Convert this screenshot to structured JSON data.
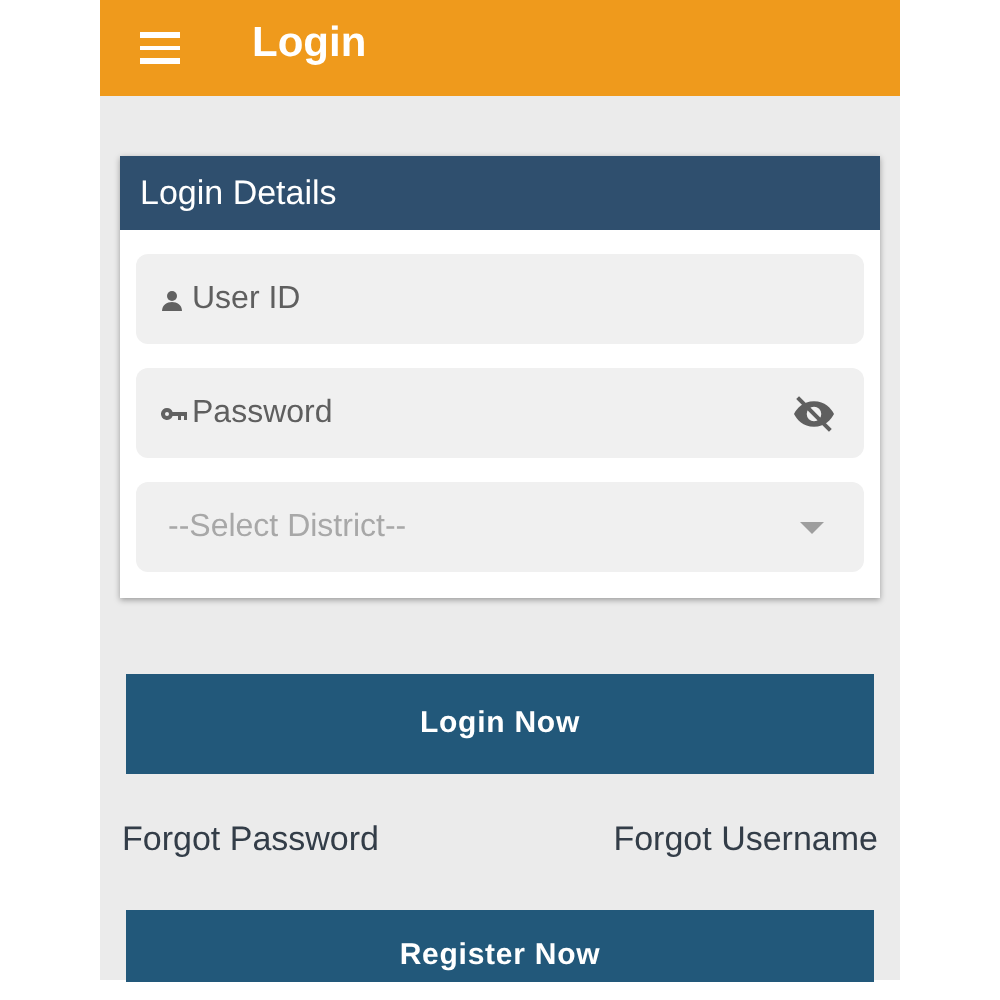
{
  "app_bar": {
    "title": "Login"
  },
  "card": {
    "title": "Login Details",
    "fields": [
      {
        "kind": "user",
        "placeholder": "User ID"
      },
      {
        "kind": "password",
        "placeholder": "Password"
      },
      {
        "kind": "select",
        "placeholder": "--Select District--"
      }
    ]
  },
  "login_button": "Login Now",
  "links": [
    "Forgot Password",
    "Forgot Username"
  ],
  "register_button": "Register Now"
}
